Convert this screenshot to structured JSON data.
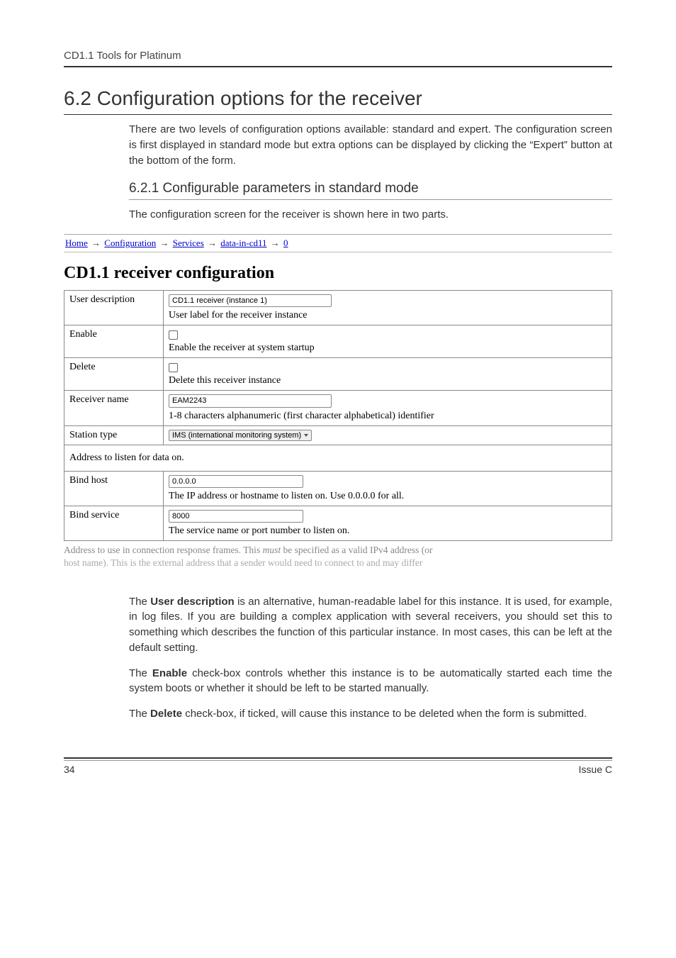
{
  "header": {
    "running": "CD1.1 Tools for Platinum"
  },
  "section": {
    "title": "6.2 Configuration options for the receiver",
    "intro": "There are two levels of configuration options available: standard and expert.  The configuration screen is first displayed in standard mode but extra options can be displayed by clicking the “Expert” button at the bottom of the form.",
    "sub_title": "6.2.1 Configurable parameters in standard mode",
    "sub_intro": "The configuration screen for the receiver is shown here in two parts."
  },
  "breadcrumb": {
    "items": [
      "Home",
      "Configuration",
      "Services",
      "data-in-cd11",
      "0"
    ],
    "sep": "→"
  },
  "config": {
    "heading": "CD1.1 receiver configuration",
    "rows": {
      "user_description": {
        "label": "User description",
        "value": "CD1.1 receiver (instance 1)",
        "help": "User label for the receiver instance"
      },
      "enable": {
        "label": "Enable",
        "help": "Enable the receiver at system startup"
      },
      "delete": {
        "label": "Delete",
        "help": "Delete this receiver instance"
      },
      "receiver_name": {
        "label": "Receiver name",
        "value": "EAM2243",
        "help": "1-8 characters alphanumeric (first character alphabetical) identifier"
      },
      "station_type": {
        "label": "Station type",
        "value": "IMS (international monitoring system)"
      },
      "address_section": "Address to listen for data on.",
      "bind_host": {
        "label": "Bind host",
        "value": "0.0.0.0",
        "help": "The IP address or hostname to listen on. Use 0.0.0.0 for all."
      },
      "bind_service": {
        "label": "Bind service",
        "value": "8000",
        "help": "The service name or port number to listen on."
      }
    },
    "faded_line1_a": "Address to use in connection response frames. This ",
    "faded_line1_must": "must",
    "faded_line1_b": " be specified as a valid IPv4 address (or",
    "faded_line2": "host name). This is the external address that a sender would need to connect to and may differ"
  },
  "explain": {
    "p1_a": "The ",
    "p1_b": "User description",
    "p1_c": " is an alternative, human-readable label for this instance.  It is used, for example, in log files.  If you are building a complex application with several receivers, you should set this to something which describes the function of this particular instance.  In most cases, this can be left at the default setting.",
    "p2_a": "The ",
    "p2_b": "Enable",
    "p2_c": " check-box controls whether this instance is to be automatically started each time the system boots or whether it should be left to be started manually.",
    "p3_a": "The ",
    "p3_b": "Delete",
    "p3_c": " check-box, if ticked, will cause this instance to be deleted when the form is submitted."
  },
  "footer": {
    "page": "34",
    "issue": "Issue C"
  }
}
